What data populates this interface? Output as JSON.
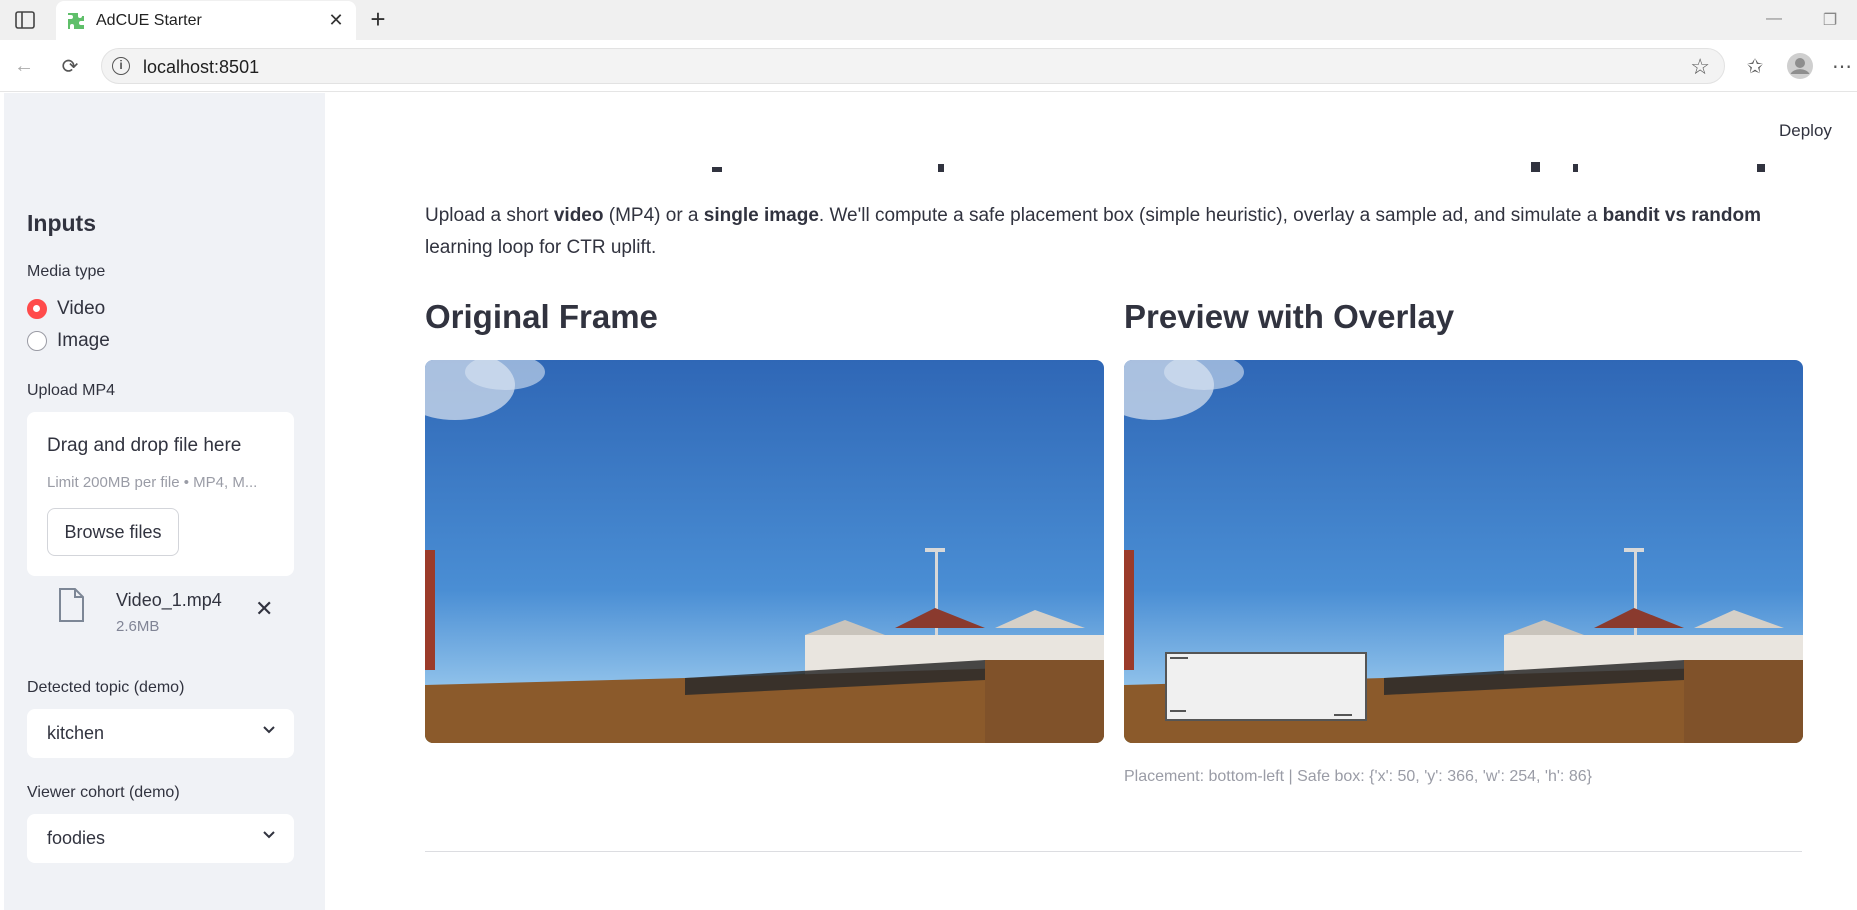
{
  "browser": {
    "tab_title": "AdCUE Starter",
    "url": "localhost:8501"
  },
  "sidebar": {
    "heading": "Inputs",
    "media_type_label": "Media type",
    "media_options": [
      {
        "label": "Video",
        "selected": true
      },
      {
        "label": "Image",
        "selected": false
      }
    ],
    "upload_label": "Upload MP4",
    "uploader": {
      "drag_text": "Drag and drop file here",
      "limit_text": "Limit 200MB per file • MP4, M...",
      "browse_label": "Browse files"
    },
    "file": {
      "name": "Video_1.mp4",
      "size": "2.6MB"
    },
    "topic_label": "Detected topic (demo)",
    "topic_value": "kitchen",
    "cohort_label": "Viewer cohort (demo)",
    "cohort_value": "foodies"
  },
  "main": {
    "deploy_label": "Deploy",
    "intro": {
      "p1": "Upload a short ",
      "b1": "video",
      "p2": " (MP4) or a ",
      "b2": "single image",
      "p3": ". We'll compute a safe placement box (simple heuristic), overlay a sample ad, and simulate a ",
      "b3": "bandit vs random",
      "p4": " learning loop for CTR uplift."
    },
    "original_heading": "Original Frame",
    "preview_heading": "Preview with Overlay",
    "caption": "Placement: bottom-left | Safe box: {'x': 50, 'y': 366, 'w': 254, 'h': 86}"
  },
  "colors": {
    "accent": "#ff4b4b",
    "sidebar_bg": "#f0f2f6",
    "text": "#31333f",
    "caption": "#9a9ca6"
  }
}
